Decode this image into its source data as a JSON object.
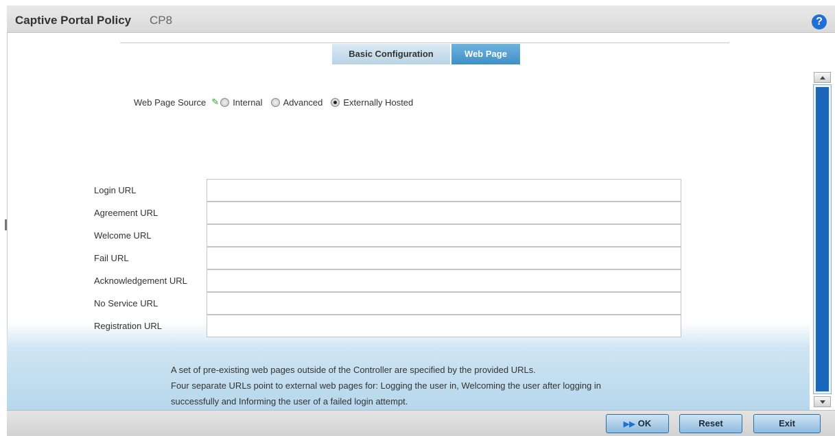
{
  "header": {
    "title": "Captive Portal Policy",
    "subtitle": "CP8",
    "help_icon": "?"
  },
  "tabs": [
    {
      "label": "Basic Configuration",
      "active": false
    },
    {
      "label": "Web Page",
      "active": true
    }
  ],
  "web_page_source": {
    "label": "Web Page Source",
    "options": [
      {
        "label": "Internal",
        "selected": false
      },
      {
        "label": "Advanced",
        "selected": false
      },
      {
        "label": "Externally Hosted",
        "selected": true
      }
    ]
  },
  "urls": {
    "login": {
      "label": "Login URL",
      "value": ""
    },
    "agreement": {
      "label": "Agreement URL",
      "value": ""
    },
    "welcome": {
      "label": "Welcome URL",
      "value": ""
    },
    "fail": {
      "label": "Fail URL",
      "value": ""
    },
    "acknowledgement": {
      "label": "Acknowledgement URL",
      "value": ""
    },
    "no_service": {
      "label": "No Service URL",
      "value": ""
    },
    "registration": {
      "label": "Registration URL",
      "value": ""
    }
  },
  "info": {
    "line1": "A set of pre-existing web pages outside of the Controller are specified by the provided URLs.",
    "line2": "Four separate URLs point to external web pages for: Logging the user in, Welcoming the user after logging in",
    "line3": "successfully and Informing the user of a failed login attempt."
  },
  "footer": {
    "ok_label": "OK",
    "reset_label": "Reset",
    "exit_label": "Exit"
  }
}
